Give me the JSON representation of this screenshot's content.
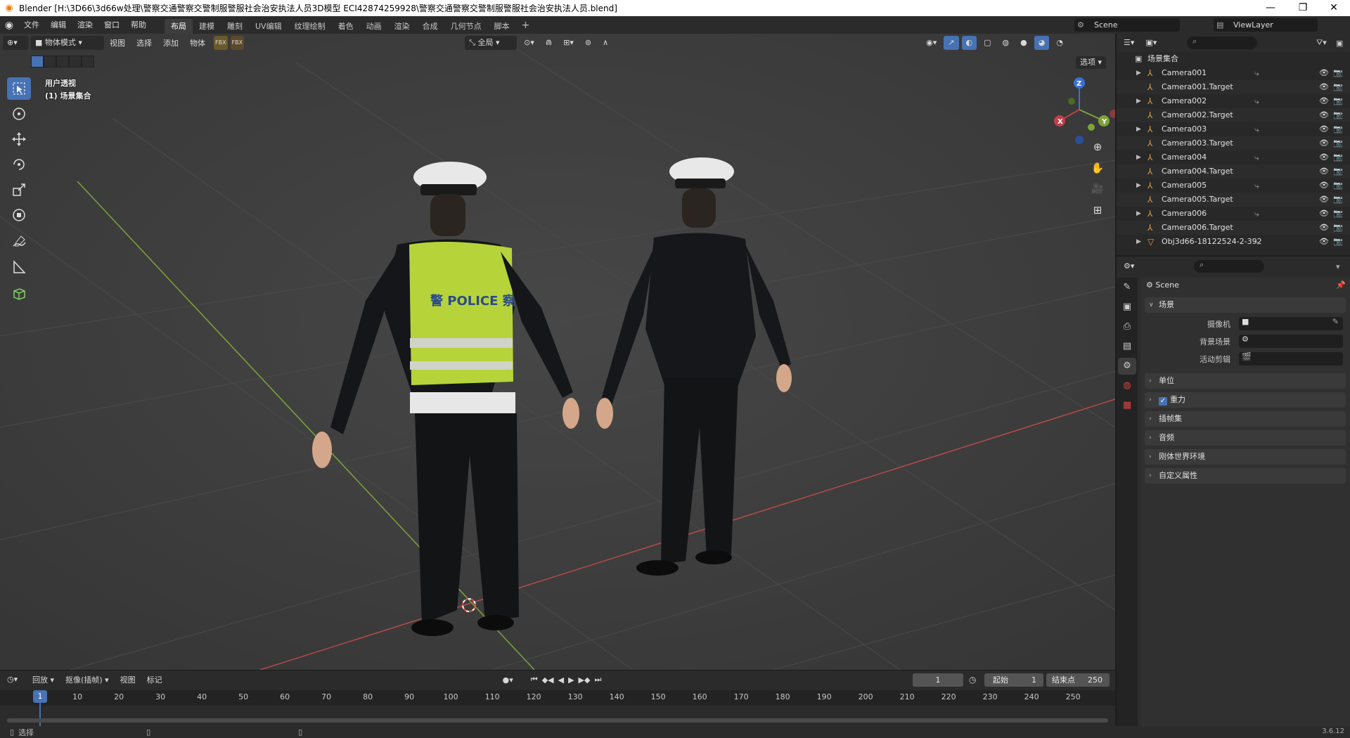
{
  "window": {
    "title": "Blender [H:\\3D66\\3d66w处理\\警察交通警察交警制服警服社会治安执法人员3D模型 ECI42874259928\\警察交通警察交警制服警服社会治安执法人员.blend]",
    "controls": [
      "—",
      "❐",
      "✕"
    ]
  },
  "menubar": {
    "items": [
      "文件",
      "编辑",
      "渲染",
      "窗口",
      "帮助"
    ],
    "workspaces": [
      "布局",
      "建模",
      "雕刻",
      "UV编辑",
      "纹理绘制",
      "着色",
      "动画",
      "渲染",
      "合成",
      "几何节点",
      "脚本"
    ],
    "active_workspace": 0,
    "add_label": "+",
    "scene_name": "Scene",
    "view_layer": "ViewLayer"
  },
  "viewport": {
    "mode": "物体模式",
    "menus": [
      "视图",
      "选择",
      "添加",
      "物体"
    ],
    "transform_orientation": "全局",
    "options_label": "选项",
    "view_name": "用户透视",
    "collection_info": "(1) 场景集合",
    "vest_text": "警 POLICE 察",
    "colors": {
      "background": "#3d3d3d",
      "grid_x": "#b84a4a",
      "grid_y": "#7ea33a",
      "vest": "#b6d43a"
    }
  },
  "tools": [
    "select-box-icon",
    "cursor-icon",
    "move-icon",
    "rotate-icon",
    "scale-icon",
    "transform-icon",
    "annotate-icon",
    "measure-icon",
    "add-cube-icon"
  ],
  "gizmo": {
    "x": "X",
    "y": "Y",
    "z": "Z"
  },
  "timeline": {
    "menus": [
      "回放",
      "抠像(插帧)",
      "视图",
      "标记"
    ],
    "current_frame": "1",
    "start_label": "起始",
    "start_value": "1",
    "end_label": "结束点",
    "end_value": "250",
    "ticks": [
      "1",
      "10",
      "20",
      "30",
      "40",
      "50",
      "60",
      "70",
      "80",
      "90",
      "100",
      "110",
      "120",
      "130",
      "140",
      "150",
      "160",
      "170",
      "180",
      "190",
      "200",
      "210",
      "220",
      "230",
      "240",
      "250"
    ]
  },
  "statusbar": {
    "select_label": "选择",
    "version": "3.6.12"
  },
  "outliner": {
    "root": "场景集合",
    "items": [
      {
        "name": "Camera001",
        "expandable": true,
        "constraint": true
      },
      {
        "name": "Camera001.Target",
        "expandable": false,
        "constraint": false
      },
      {
        "name": "Camera002",
        "expandable": true,
        "constraint": true
      },
      {
        "name": "Camera002.Target",
        "expandable": false,
        "constraint": false
      },
      {
        "name": "Camera003",
        "expandable": true,
        "constraint": true
      },
      {
        "name": "Camera003.Target",
        "expandable": false,
        "constraint": false
      },
      {
        "name": "Camera004",
        "expandable": true,
        "constraint": true
      },
      {
        "name": "Camera004.Target",
        "expandable": false,
        "constraint": false
      },
      {
        "name": "Camera005",
        "expandable": true,
        "constraint": true
      },
      {
        "name": "Camera005.Target",
        "expandable": false,
        "constraint": false
      },
      {
        "name": "Camera006",
        "expandable": true,
        "constraint": true
      },
      {
        "name": "Camera006.Target",
        "expandable": false,
        "constraint": false
      },
      {
        "name": "Obj3d66-18122524-2-392",
        "expandable": true,
        "constraint": true
      }
    ]
  },
  "properties": {
    "context": "Scene",
    "scene_panel": "场景",
    "camera_label": "摄像机",
    "background_scene_label": "背景场景",
    "active_clip_label": "活动剪辑",
    "panels": [
      "单位",
      "重力",
      "插帧集",
      "音频",
      "刚体世界环境",
      "自定义属性"
    ],
    "gravity_checked": true
  }
}
